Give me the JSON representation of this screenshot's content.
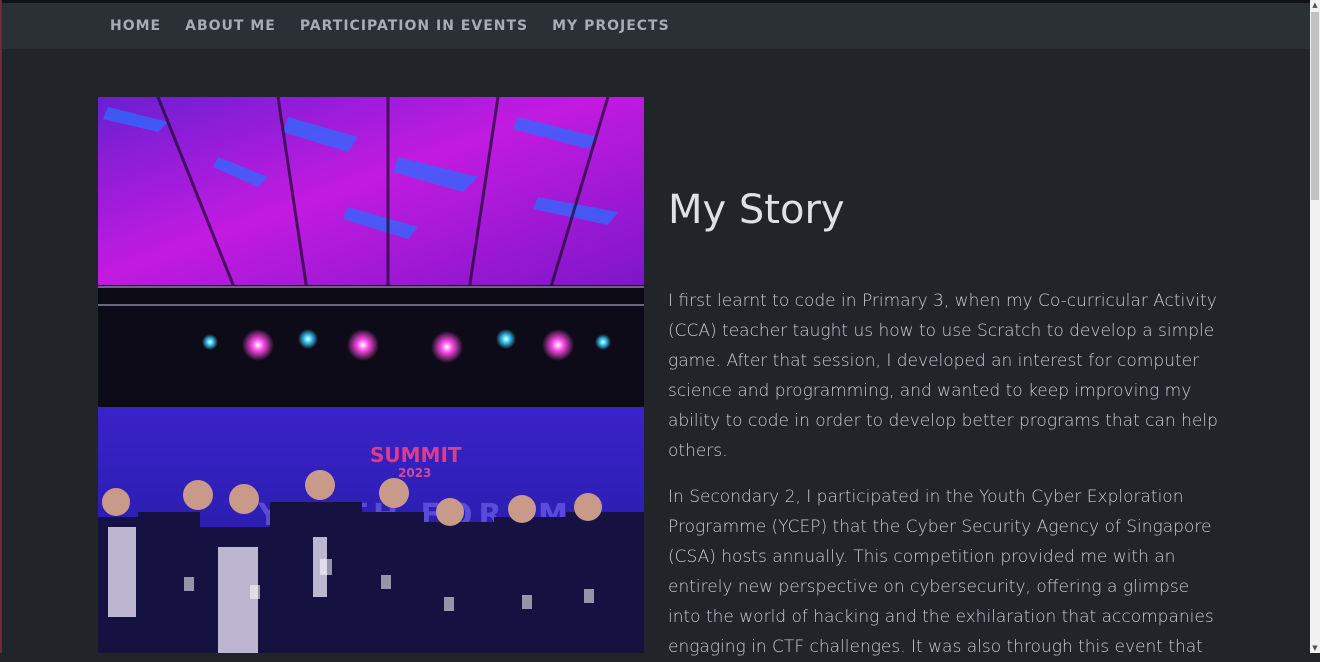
{
  "nav": {
    "items": [
      {
        "label": "HOME"
      },
      {
        "label": "ABOUT ME"
      },
      {
        "label": "PARTICIPATION IN EVENTS"
      },
      {
        "label": "MY PROJECTS"
      }
    ]
  },
  "photo": {
    "backdrop_text": "YOUTH FORUM",
    "logo_text": "SUMMIT",
    "year_text": "2023"
  },
  "story": {
    "title": "My Story",
    "paragraphs": [
      "I first learnt to code in Primary 3, when my Co-curricular Activity (CCA) teacher taught us how to use Scratch to develop a simple game. After that session, I developed an interest for computer science and programming, and wanted to keep improving my ability to code in order to develop better programs that can help others.",
      "In Secondary 2, I participated in the Youth Cyber Exploration Programme (YCEP) that the Cyber Security Agency of Singapore (CSA) hosts annually. This competition provided me with an entirely new perspective on cybersecurity, offering a glimpse into the world of hacking and the exhilaration that accompanies engaging in CTF challenges. It was also through this event that"
    ]
  },
  "colors": {
    "background": "#212529",
    "navbar": "#2b3035",
    "nav_text": "#a9adb3",
    "heading": "#dee2e6",
    "body_text": "#c9cdd2"
  },
  "scrollbar": {
    "up_icon": "triangle-up",
    "down_icon": "triangle-down"
  }
}
